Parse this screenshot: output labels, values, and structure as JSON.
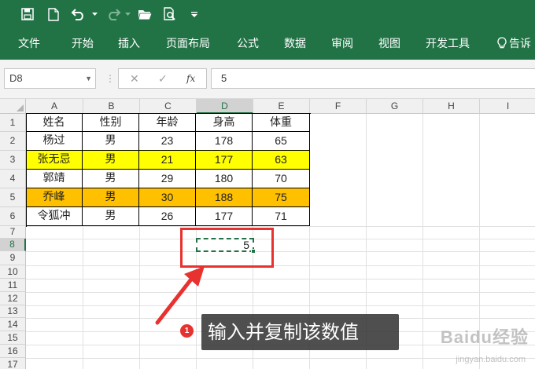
{
  "app": {
    "accent_color": "#217346",
    "quick_access_icons": [
      "save-icon",
      "new-file-icon",
      "undo-icon",
      "redo-icon",
      "open-folder-icon",
      "print-preview-icon",
      "customize-icon"
    ]
  },
  "ribbon": {
    "tabs": [
      {
        "label": "文件"
      },
      {
        "label": "开始"
      },
      {
        "label": "插入"
      },
      {
        "label": "页面布局"
      },
      {
        "label": "公式"
      },
      {
        "label": "数据"
      },
      {
        "label": "审阅"
      },
      {
        "label": "视图"
      },
      {
        "label": "开发工具"
      },
      {
        "label": "告诉"
      }
    ]
  },
  "formula_bar": {
    "name_box": "D8",
    "fx_label": "fx",
    "cancel_symbol": "✕",
    "enter_symbol": "✓",
    "content": "5"
  },
  "sheet": {
    "columns": [
      "A",
      "B",
      "C",
      "D",
      "E",
      "F",
      "G",
      "H",
      "I"
    ],
    "selected_column": "D",
    "rows": [
      "1",
      "2",
      "3",
      "4",
      "5",
      "6",
      "7",
      "8",
      "9",
      "10",
      "11",
      "12",
      "13",
      "14",
      "15",
      "16",
      "17"
    ],
    "selected_row": "8",
    "header": [
      "姓名",
      "性别",
      "年龄",
      "身高",
      "体重"
    ],
    "data": [
      {
        "cells": [
          "杨过",
          "男",
          "23",
          "178",
          "65"
        ],
        "fill": "#ffffff"
      },
      {
        "cells": [
          "张无忌",
          "男",
          "21",
          "177",
          "63"
        ],
        "fill": "#ffff00"
      },
      {
        "cells": [
          "郭靖",
          "男",
          "29",
          "180",
          "70"
        ],
        "fill": "#ffffff"
      },
      {
        "cells": [
          "乔峰",
          "男",
          "30",
          "188",
          "75"
        ],
        "fill": "#ffc000"
      },
      {
        "cells": [
          "令狐冲",
          "男",
          "26",
          "177",
          "71"
        ],
        "fill": "#ffffff"
      }
    ],
    "active_cell": {
      "ref": "D8",
      "value": "5"
    }
  },
  "annotation": {
    "step": "1",
    "text": "输入并复制该数值",
    "color": "#e8322f"
  },
  "watermark": {
    "text": "Baidu经验",
    "sub": "jingyan.baidu.com"
  }
}
